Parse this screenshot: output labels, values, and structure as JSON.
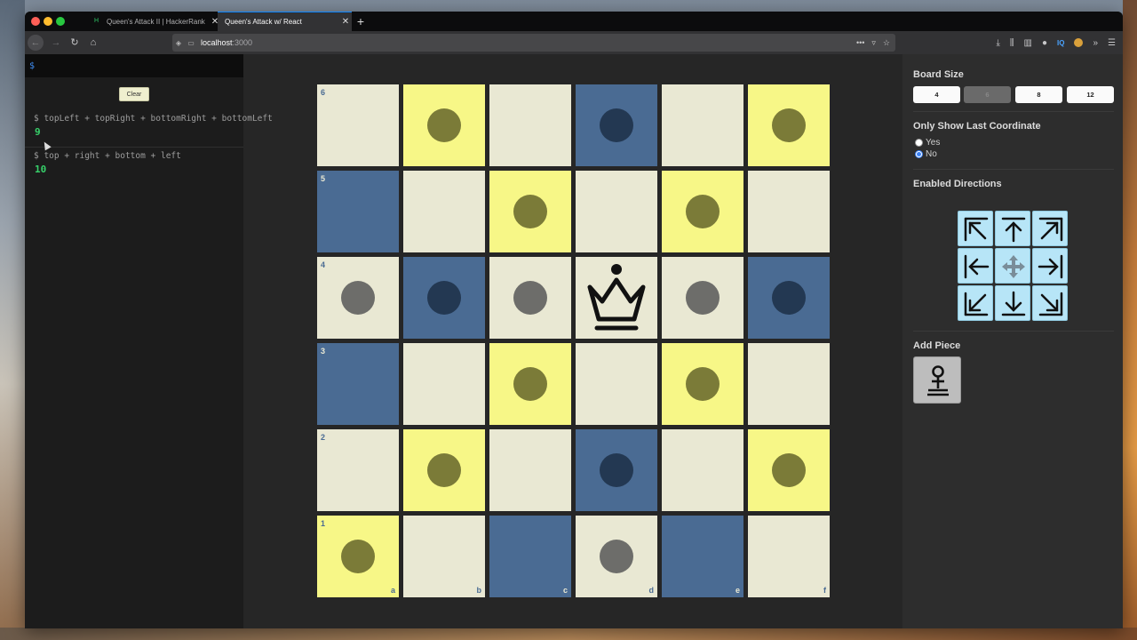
{
  "browser": {
    "tabs": [
      {
        "label": "Queen's Attack II | HackerRank",
        "favicon": "hackerrank-icon",
        "active": false
      },
      {
        "label": "Queen's Attack w/ React",
        "active": true
      }
    ],
    "url_host": "localhost",
    "url_port": ":3000"
  },
  "console": {
    "prompt": "$",
    "clear_label": "Clear",
    "entries": [
      {
        "command": "$ topLeft + topRight + bottomRight + bottomLeft",
        "result": "9"
      },
      {
        "command": "$ top + right + bottom + left",
        "result": "10"
      }
    ]
  },
  "board": {
    "size": 6,
    "ranks": [
      "6",
      "5",
      "4",
      "3",
      "2",
      "1"
    ],
    "files": [
      "a",
      "b",
      "c",
      "d",
      "e",
      "f"
    ],
    "queen": "d4",
    "queen_piece": "queen-icon",
    "highlighted": [
      "b6",
      "d6",
      "f6",
      "c5",
      "e5",
      "a4",
      "b4",
      "c4",
      "e4",
      "f4",
      "c3",
      "e3",
      "b2",
      "d2",
      "f2",
      "a1",
      "d1"
    ],
    "yellow_squares": [
      "b6",
      "f6",
      "c5",
      "e5",
      "c3",
      "e3",
      "b2",
      "f2",
      "a1"
    ],
    "colors": {
      "dark": "#4a6b93",
      "light": "#e9e8d3",
      "attack": "#f7f787"
    }
  },
  "panel": {
    "board_size_title": "Board Size",
    "board_sizes": [
      "4",
      "6",
      "8",
      "12"
    ],
    "board_size_selected": "6",
    "last_coord_title": "Only Show Last Coordinate",
    "yes_label": "Yes",
    "no_label": "No",
    "last_coord_selected": "No",
    "directions_title": "Enabled Directions",
    "directions": [
      "top-left",
      "top",
      "top-right",
      "left",
      "all",
      "right",
      "bottom-left",
      "bottom",
      "bottom-right"
    ],
    "add_piece_title": "Add Piece",
    "add_piece_icon": "pawn-icon"
  }
}
